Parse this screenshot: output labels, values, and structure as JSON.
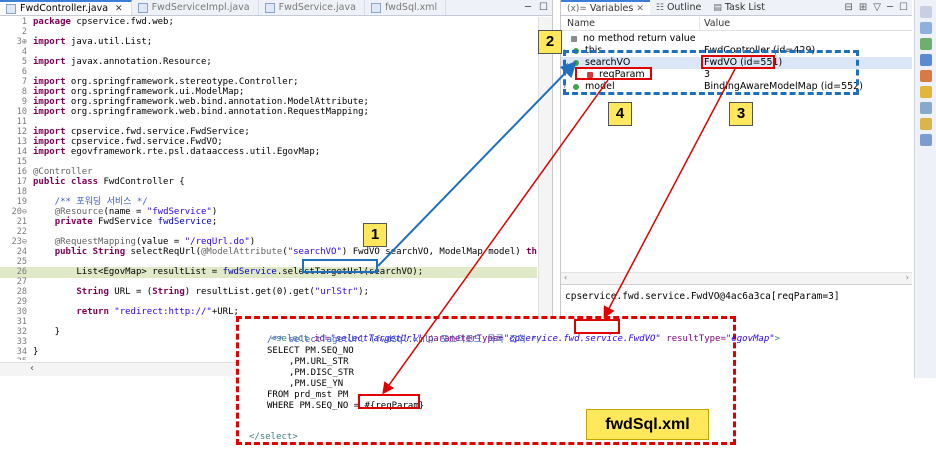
{
  "editor": {
    "tabs": [
      {
        "label": "FwdController.java",
        "active": true
      },
      {
        "label": "FwdServiceImpl.java",
        "active": false
      },
      {
        "label": "FwdService.java",
        "active": false
      },
      {
        "label": "fwdSql.xml",
        "active": false
      }
    ],
    "code_lines": [
      {
        "n": "1",
        "text": "package cpservice.fwd.web;"
      },
      {
        "n": "2",
        "text": ""
      },
      {
        "n": "3⊕",
        "text": "import java.util.List;"
      },
      {
        "n": "4",
        "text": ""
      },
      {
        "n": "5",
        "text": "import javax.annotation.Resource;"
      },
      {
        "n": "6",
        "text": ""
      },
      {
        "n": "7",
        "text": "import org.springframework.stereotype.Controller;"
      },
      {
        "n": "8",
        "text": "import org.springframework.ui.ModelMap;"
      },
      {
        "n": "9",
        "text": "import org.springframework.web.bind.annotation.ModelAttribute;"
      },
      {
        "n": "10",
        "text": "import org.springframework.web.bind.annotation.RequestMapping;"
      },
      {
        "n": "11",
        "text": ""
      },
      {
        "n": "12",
        "text": "import cpservice.fwd.service.FwdService;"
      },
      {
        "n": "13",
        "text": "import cpservice.fwd.service.FwdVO;"
      },
      {
        "n": "14",
        "text": "import egovframework.rte.psl.dataaccess.util.EgovMap;"
      },
      {
        "n": "15",
        "text": ""
      },
      {
        "n": "16",
        "text": "@Controller"
      },
      {
        "n": "17",
        "text": "public class FwdController {"
      },
      {
        "n": "18",
        "text": ""
      },
      {
        "n": "19",
        "text": "    /** 포워딩 서비스 */"
      },
      {
        "n": "20⊖",
        "text": "    @Resource(name = \"fwdService\")"
      },
      {
        "n": "21",
        "text": "    private FwdService fwdService;"
      },
      {
        "n": "22",
        "text": ""
      },
      {
        "n": "23⊖",
        "text": "    @RequestMapping(value = \"/reqUrl.do\")"
      },
      {
        "n": "24",
        "text": "    public String selectReqUrl(@ModelAttribute(\"searchVO\") FwdVO searchVO, ModelMap model) throws Exception {"
      },
      {
        "n": "25",
        "text": ""
      },
      {
        "n": "26",
        "text": "        List<EgovMap> resultList = fwdService.selectTargetUrl(searchVO);"
      },
      {
        "n": "27",
        "text": ""
      },
      {
        "n": "28",
        "text": "        String URL = (String) resultList.get(0).get(\"urlStr\");"
      },
      {
        "n": "29",
        "text": ""
      },
      {
        "n": "30",
        "text": "        return \"redirect:http://\"+URL;"
      },
      {
        "n": "31",
        "text": ""
      },
      {
        "n": "32",
        "text": "    }"
      },
      {
        "n": "33",
        "text": ""
      },
      {
        "n": "34",
        "text": "}"
      },
      {
        "n": "35",
        "text": ""
      }
    ]
  },
  "variables_view": {
    "tabs": [
      {
        "label": "Variables",
        "icon": "variables-icon"
      },
      {
        "label": "Outline",
        "icon": "outline-icon"
      },
      {
        "label": "Task List",
        "icon": "task-list-icon"
      }
    ],
    "col_name": "Name",
    "col_value": "Value",
    "rows": [
      {
        "name": "no method return value",
        "value": "",
        "indent": 0
      },
      {
        "name": "this",
        "value": "FwdController (id=429)",
        "indent": 0
      },
      {
        "name": "searchVO",
        "value": "FwdVO  (id=551)",
        "indent": 0,
        "selected": true
      },
      {
        "name": "reqParam",
        "value": "3",
        "indent": 1
      },
      {
        "name": "model",
        "value": "BindingAwareModelMap  (id=552)",
        "indent": 0
      }
    ],
    "detail": "cpservice.fwd.service.FwdVO@4ac6a3ca[reqParam=3]"
  },
  "sql_box": {
    "lines": [
      "<select id=\"selectTargetUrl\" parameterType=\"cpservice.fwd.service.FwdVO\" resultType=\"egovMap\">",
      "/** selectTagetUrl (fwdSql.xml) 포스터코드 목록 조회 */",
      "SELECT PM.SEQ_NO",
      ",PM.URL_STR",
      ",PM.DISC_STR",
      ",PM.USE_YN",
      "FROM prd_mst PM",
      "WHERE PM.SEQ_NO = ",
      "#{reqParam}",
      "</select>"
    ],
    "label": "fwdSql.xml"
  },
  "callouts": [
    "1",
    "2",
    "3",
    "4"
  ],
  "colors": {
    "accent_red": "#e00000",
    "accent_blue": "#1f6fbf",
    "callout_yellow": "#ffe85c"
  }
}
